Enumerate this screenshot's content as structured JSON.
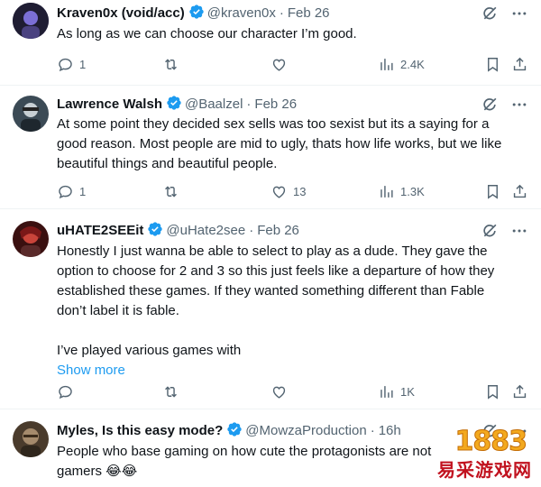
{
  "tweets": [
    {
      "name": "Kraven0x (void/acc)",
      "handle": "@kraven0x",
      "sep": "·",
      "date": "Feb 26",
      "text_lines": [
        "As long as we can choose our character I’m good."
      ],
      "show_more": "",
      "replies": "1",
      "retweets": "",
      "likes": "",
      "views": "2.4K",
      "avatar_colors": [
        "#1b1a2e",
        "#6a5acd"
      ]
    },
    {
      "name": "Lawrence Walsh",
      "handle": "@Baalzel",
      "sep": "·",
      "date": "Feb 26",
      "text_lines": [
        "At some point they decided sex sells was too sexist but its a saying for a",
        "good reason.  Most people are mid to ugly, thats how life works, but we like",
        "beautiful things and beautiful people."
      ],
      "show_more": "",
      "replies": "1",
      "retweets": "",
      "likes": "13",
      "views": "1.3K",
      "avatar_colors": [
        "#2d3a45",
        "#8a9ba6"
      ]
    },
    {
      "name": "uHATE2SEEit",
      "handle": "@uHate2see",
      "sep": "·",
      "date": "Feb 26",
      "text_lines": [
        "Honestly I just wanna be able to select to play as a dude. They gave the",
        "option to choose for 2 and 3 so this just feels like a departure of how they",
        "established these games. If they wanted something different than Fable",
        "don’t label it is fable.",
        "",
        "I’ve played various games with"
      ],
      "show_more": "Show more",
      "replies": "",
      "retweets": "",
      "likes": "",
      "views": "1K",
      "avatar_colors": [
        "#7a1a1a",
        "#d14b3a"
      ]
    },
    {
      "name": "Myles, Is this easy mode?",
      "handle": "@MowzaProduction",
      "sep": "·",
      "date": "16h",
      "text_lines": [
        "People who base gaming on how cute the protagonists are not",
        "gamers 😂😂"
      ],
      "show_more": "",
      "replies": "",
      "retweets": "",
      "likes": "",
      "views": "",
      "avatar_colors": [
        "#5a4a3a",
        "#a08a70"
      ]
    }
  ],
  "watermark": {
    "number": "1883",
    "text": "易采游戏网"
  },
  "colors": {
    "verified": "#1d9bf0",
    "muted": "#536471",
    "text": "#0f1419",
    "link": "#1d9bf0"
  }
}
